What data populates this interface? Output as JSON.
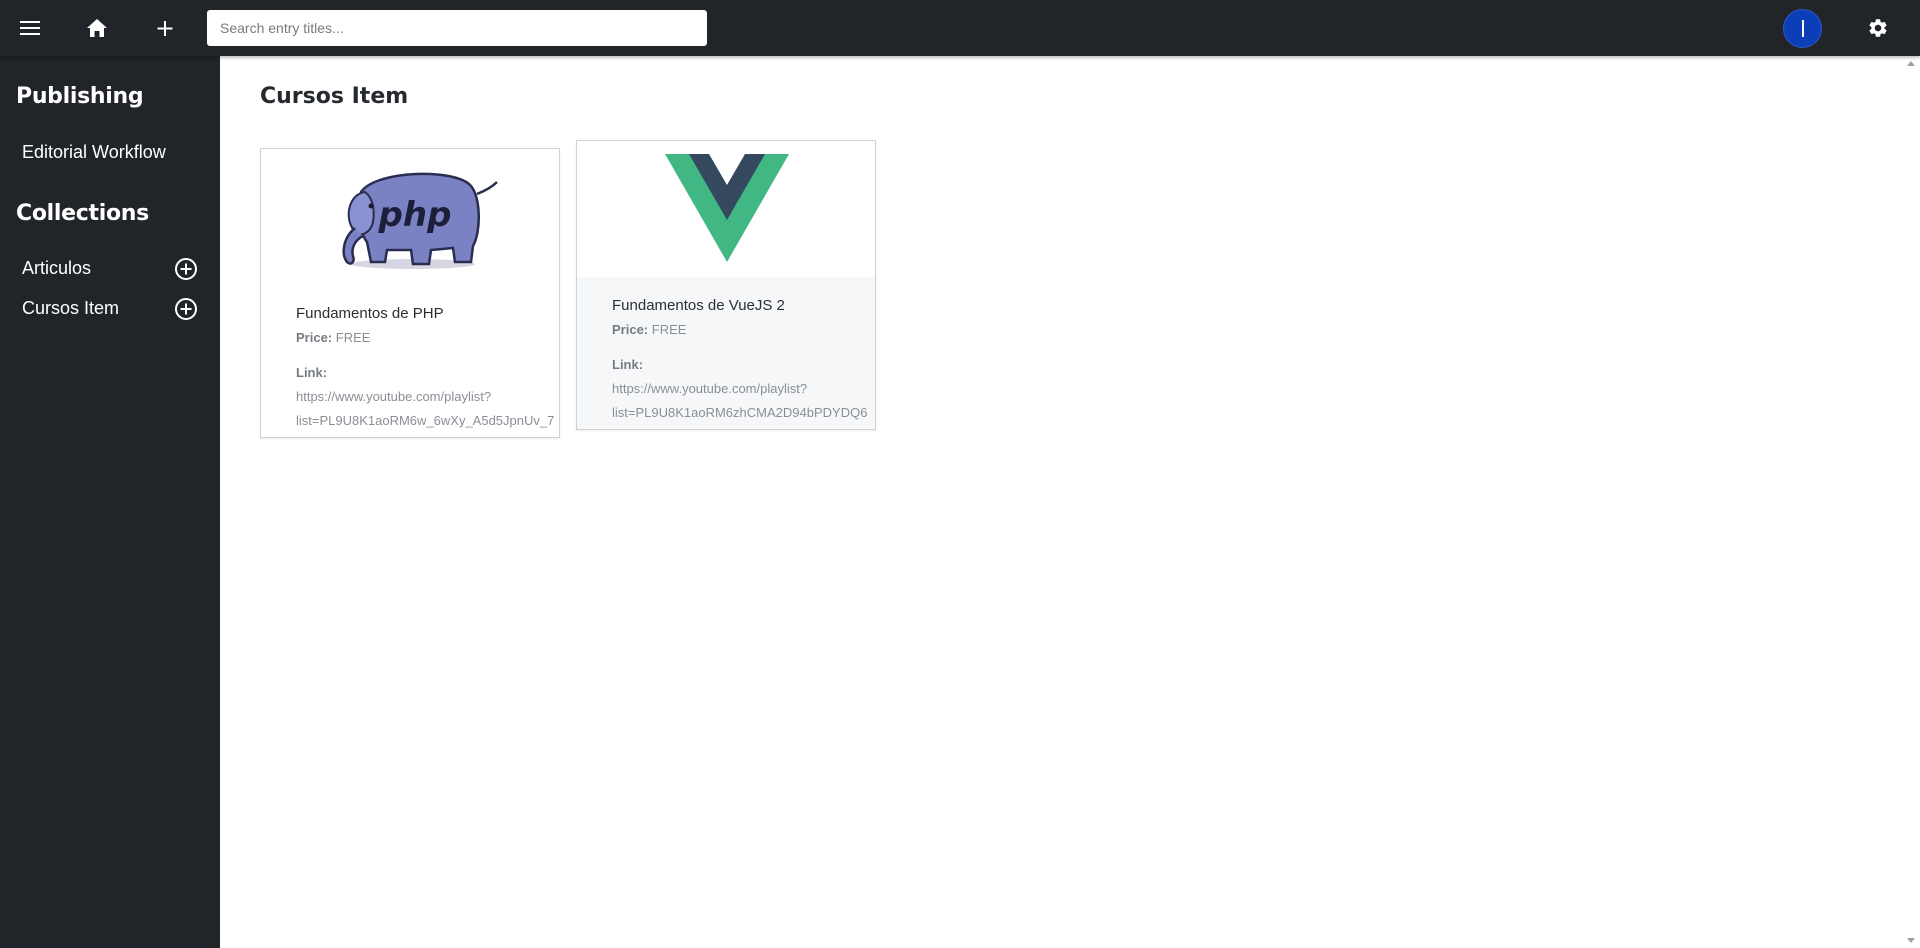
{
  "topbar": {
    "menu_icon": "hamburger-menu-icon",
    "home_icon": "home-icon",
    "add_icon": "plus-icon",
    "search": {
      "placeholder": "Search entry titles...",
      "value": ""
    },
    "avatar_initial": "I",
    "avatar_color": "#0c3fb7",
    "settings_icon": "gear-icon",
    "background": "#212429"
  },
  "sidebar": {
    "publishing_heading": "Publishing",
    "workflow_label": "Editorial Workflow",
    "collections_heading": "Collections",
    "collections": [
      {
        "label": "Articulos",
        "add_icon": "plus-circle-icon"
      },
      {
        "label": "Cursos Item",
        "add_icon": "plus-circle-icon"
      }
    ]
  },
  "main": {
    "title": "Cursos Item",
    "cards": [
      {
        "image": "php-elephant-logo",
        "title": "Fundamentos de PHP",
        "price_label": "Price:",
        "price": "FREE",
        "link_label": "Link:",
        "link_line1": "https://www.youtube.com/playlist?",
        "link_line2": "list=PL9U8K1aoRM6w_6wXy_A5d5JpnUv_7"
      },
      {
        "image": "vuejs-logo",
        "title": "Fundamentos de VueJS 2",
        "price_label": "Price:",
        "price": "FREE",
        "link_label": "Link:",
        "link_line1": "https://www.youtube.com/playlist?",
        "link_line2": "list=PL9U8K1aoRM6zhCMA2D94bPDYDQ6"
      }
    ]
  }
}
